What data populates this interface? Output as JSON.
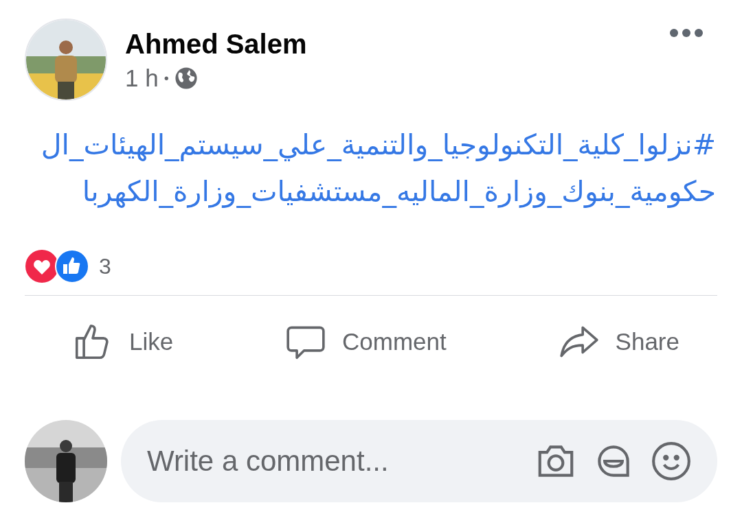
{
  "post": {
    "author": "Ahmed Salem",
    "time": "1 h",
    "separator": "•",
    "text_lines": [
      "#نزلوا_كلية_التكنولوجيا_والتنمية_علي_سيستم_الهيئات_ال",
      "حكومية_بنوك_وزارة_الماليه_مستشفيات_وزارة_الكهربا"
    ],
    "reaction_count": "3"
  },
  "actions": [
    {
      "kind": "like",
      "label": "Like"
    },
    {
      "kind": "comment",
      "label": "Comment"
    },
    {
      "kind": "share",
      "label": "Share"
    }
  ],
  "comment_box": {
    "placeholder": "Write a comment..."
  }
}
